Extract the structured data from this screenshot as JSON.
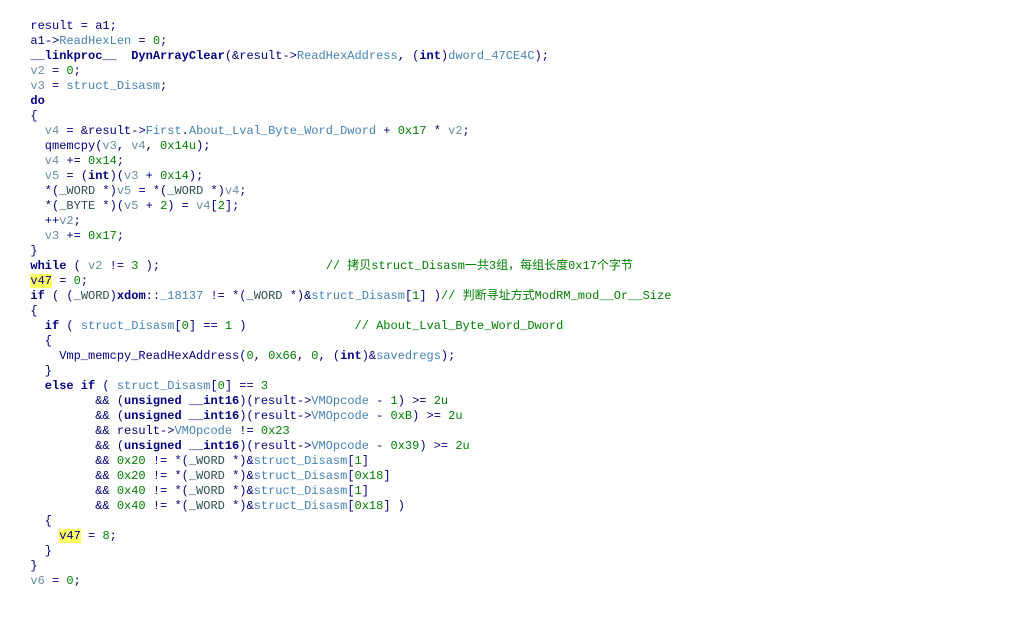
{
  "code": {
    "lines": [
      [
        [
          "ident",
          "  result"
        ],
        [
          "op",
          " = "
        ],
        [
          "ident",
          "a1"
        ],
        [
          "op",
          ";"
        ]
      ],
      [
        [
          "ident",
          "  a1"
        ],
        [
          "op",
          "->"
        ],
        [
          "field",
          "ReadHexLen"
        ],
        [
          "op",
          " = "
        ],
        [
          "num",
          "0"
        ],
        [
          "op",
          ";"
        ]
      ],
      [
        [
          "kw",
          "  __linkproc__  DynArrayClear"
        ],
        [
          "op",
          "(&"
        ],
        [
          "ident",
          "result"
        ],
        [
          "op",
          "->"
        ],
        [
          "field",
          "ReadHexAddress"
        ],
        [
          "op",
          ", ("
        ],
        [
          "kw",
          "int"
        ],
        [
          "op",
          ")"
        ],
        [
          "field",
          "dword_47CE4C"
        ],
        [
          "op",
          ");"
        ]
      ],
      [
        [
          "var",
          "  v2"
        ],
        [
          "op",
          " = "
        ],
        [
          "num",
          "0"
        ],
        [
          "op",
          ";"
        ]
      ],
      [
        [
          "var",
          "  v3"
        ],
        [
          "op",
          " = "
        ],
        [
          "field",
          "struct_Disasm"
        ],
        [
          "op",
          ";"
        ]
      ],
      [
        [
          "kw",
          "  do"
        ]
      ],
      [
        [
          "op",
          "  {"
        ]
      ],
      [
        [
          "var",
          "    v4"
        ],
        [
          "op",
          " = &"
        ],
        [
          "ident",
          "result"
        ],
        [
          "op",
          "->"
        ],
        [
          "field",
          "First"
        ],
        [
          "op",
          "."
        ],
        [
          "field",
          "About_Lval_Byte_Word_Dword"
        ],
        [
          "op",
          " + "
        ],
        [
          "num",
          "0x17"
        ],
        [
          "op",
          " * "
        ],
        [
          "var",
          "v2"
        ],
        [
          "op",
          ";"
        ]
      ],
      [
        [
          "func",
          "    qmemcpy"
        ],
        [
          "op",
          "("
        ],
        [
          "var",
          "v3"
        ],
        [
          "op",
          ", "
        ],
        [
          "var",
          "v4"
        ],
        [
          "op",
          ", "
        ],
        [
          "num",
          "0x14u"
        ],
        [
          "op",
          ");"
        ]
      ],
      [
        [
          "var",
          "    v4"
        ],
        [
          "op",
          " += "
        ],
        [
          "num",
          "0x14"
        ],
        [
          "op",
          ";"
        ]
      ],
      [
        [
          "var",
          "    v5"
        ],
        [
          "op",
          " = ("
        ],
        [
          "kw",
          "int"
        ],
        [
          "op",
          ")("
        ],
        [
          "var",
          "v3"
        ],
        [
          "op",
          " + "
        ],
        [
          "num",
          "0x14"
        ],
        [
          "op",
          ");"
        ]
      ],
      [
        [
          "op",
          "    *("
        ],
        [
          "faint",
          "_WORD"
        ],
        [
          "op",
          " *)"
        ],
        [
          "var",
          "v5"
        ],
        [
          "op",
          " = *("
        ],
        [
          "faint",
          "_WORD"
        ],
        [
          "op",
          " *)"
        ],
        [
          "var",
          "v4"
        ],
        [
          "op",
          ";"
        ]
      ],
      [
        [
          "op",
          "    *("
        ],
        [
          "faint",
          "_BYTE"
        ],
        [
          "op",
          " *)("
        ],
        [
          "var",
          "v5"
        ],
        [
          "op",
          " + "
        ],
        [
          "num",
          "2"
        ],
        [
          "op",
          ") = "
        ],
        [
          "var",
          "v4"
        ],
        [
          "op",
          "["
        ],
        [
          "num",
          "2"
        ],
        [
          "op",
          "];"
        ]
      ],
      [
        [
          "op",
          "    ++"
        ],
        [
          "var",
          "v2"
        ],
        [
          "op",
          ";"
        ]
      ],
      [
        [
          "var",
          "    v3"
        ],
        [
          "op",
          " += "
        ],
        [
          "num",
          "0x17"
        ],
        [
          "op",
          ";"
        ]
      ],
      [
        [
          "op",
          "  }"
        ]
      ],
      [
        [
          "kw",
          "  while"
        ],
        [
          "op",
          " ( "
        ],
        [
          "var",
          "v2"
        ],
        [
          "op",
          " != "
        ],
        [
          "num",
          "3"
        ],
        [
          "op",
          " );                       "
        ],
        [
          "comment",
          "// 拷贝struct_Disasm一共3组，每组长度0x17个字节"
        ]
      ],
      [
        [
          "op",
          "  "
        ],
        [
          "hl",
          "v47"
        ],
        [
          "op",
          " = "
        ],
        [
          "num",
          "0"
        ],
        [
          "op",
          ";"
        ]
      ],
      [
        [
          "kw",
          "  if"
        ],
        [
          "op",
          " ( ("
        ],
        [
          "faint",
          "_WORD"
        ],
        [
          "op",
          ")"
        ],
        [
          "kw",
          "xdom"
        ],
        [
          "op",
          "::"
        ],
        [
          "field",
          "_18137"
        ],
        [
          "op",
          " != *("
        ],
        [
          "faint",
          "_WORD"
        ],
        [
          "op",
          " *)&"
        ],
        [
          "field",
          "struct_Disasm"
        ],
        [
          "op",
          "["
        ],
        [
          "num",
          "1"
        ],
        [
          "op",
          "] )"
        ],
        [
          "comment",
          "// 判断寻址方式ModRM_mod__Or__Size"
        ]
      ],
      [
        [
          "op",
          "  {"
        ]
      ],
      [
        [
          "kw",
          "    if"
        ],
        [
          "op",
          " ( "
        ],
        [
          "field",
          "struct_Disasm"
        ],
        [
          "op",
          "["
        ],
        [
          "num",
          "0"
        ],
        [
          "op",
          "] == "
        ],
        [
          "num",
          "1"
        ],
        [
          "op",
          " )               "
        ],
        [
          "comment",
          "// About_Lval_Byte_Word_Dword"
        ]
      ],
      [
        [
          "op",
          "    {"
        ]
      ],
      [
        [
          "func",
          "      Vmp_memcpy_ReadHexAddress"
        ],
        [
          "op",
          "("
        ],
        [
          "num",
          "0"
        ],
        [
          "op",
          ", "
        ],
        [
          "num",
          "0x66"
        ],
        [
          "op",
          ", "
        ],
        [
          "num",
          "0"
        ],
        [
          "op",
          ", ("
        ],
        [
          "kw",
          "int"
        ],
        [
          "op",
          ")&"
        ],
        [
          "field",
          "savedregs"
        ],
        [
          "op",
          ");"
        ]
      ],
      [
        [
          "op",
          "    }"
        ]
      ],
      [
        [
          "kw",
          "    else if"
        ],
        [
          "op",
          " ( "
        ],
        [
          "field",
          "struct_Disasm"
        ],
        [
          "op",
          "["
        ],
        [
          "num",
          "0"
        ],
        [
          "op",
          "] == "
        ],
        [
          "num",
          "3"
        ]
      ],
      [
        [
          "op",
          "           && ("
        ],
        [
          "kw",
          "unsigned __int16"
        ],
        [
          "op",
          ")("
        ],
        [
          "ident",
          "result"
        ],
        [
          "op",
          "->"
        ],
        [
          "field",
          "VMOpcode"
        ],
        [
          "op",
          " - "
        ],
        [
          "num",
          "1"
        ],
        [
          "op",
          ") >= "
        ],
        [
          "num",
          "2u"
        ]
      ],
      [
        [
          "op",
          "           && ("
        ],
        [
          "kw",
          "unsigned __int16"
        ],
        [
          "op",
          ")("
        ],
        [
          "ident",
          "result"
        ],
        [
          "op",
          "->"
        ],
        [
          "field",
          "VMOpcode"
        ],
        [
          "op",
          " - "
        ],
        [
          "num",
          "0xB"
        ],
        [
          "op",
          ") >= "
        ],
        [
          "num",
          "2u"
        ]
      ],
      [
        [
          "op",
          "           && "
        ],
        [
          "ident",
          "result"
        ],
        [
          "op",
          "->"
        ],
        [
          "field",
          "VMOpcode"
        ],
        [
          "op",
          " != "
        ],
        [
          "num",
          "0x23"
        ]
      ],
      [
        [
          "op",
          "           && ("
        ],
        [
          "kw",
          "unsigned __int16"
        ],
        [
          "op",
          ")("
        ],
        [
          "ident",
          "result"
        ],
        [
          "op",
          "->"
        ],
        [
          "field",
          "VMOpcode"
        ],
        [
          "op",
          " - "
        ],
        [
          "num",
          "0x39"
        ],
        [
          "op",
          ") >= "
        ],
        [
          "num",
          "2u"
        ]
      ],
      [
        [
          "op",
          "           && "
        ],
        [
          "num",
          "0x20"
        ],
        [
          "op",
          " != *("
        ],
        [
          "faint",
          "_WORD"
        ],
        [
          "op",
          " *)&"
        ],
        [
          "field",
          "struct_Disasm"
        ],
        [
          "op",
          "["
        ],
        [
          "num",
          "1"
        ],
        [
          "op",
          "]"
        ]
      ],
      [
        [
          "op",
          "           && "
        ],
        [
          "num",
          "0x20"
        ],
        [
          "op",
          " != *("
        ],
        [
          "faint",
          "_WORD"
        ],
        [
          "op",
          " *)&"
        ],
        [
          "field",
          "struct_Disasm"
        ],
        [
          "op",
          "["
        ],
        [
          "num",
          "0x18"
        ],
        [
          "op",
          "]"
        ]
      ],
      [
        [
          "op",
          "           && "
        ],
        [
          "num",
          "0x40"
        ],
        [
          "op",
          " != *("
        ],
        [
          "faint",
          "_WORD"
        ],
        [
          "op",
          " *)&"
        ],
        [
          "field",
          "struct_Disasm"
        ],
        [
          "op",
          "["
        ],
        [
          "num",
          "1"
        ],
        [
          "op",
          "]"
        ]
      ],
      [
        [
          "op",
          "           && "
        ],
        [
          "num",
          "0x40"
        ],
        [
          "op",
          " != *("
        ],
        [
          "faint",
          "_WORD"
        ],
        [
          "op",
          " *)&"
        ],
        [
          "field",
          "struct_Disasm"
        ],
        [
          "op",
          "["
        ],
        [
          "num",
          "0x18"
        ],
        [
          "op",
          "] )"
        ]
      ],
      [
        [
          "op",
          "    {"
        ]
      ],
      [
        [
          "op",
          "      "
        ],
        [
          "hl",
          "v47"
        ],
        [
          "op",
          " = "
        ],
        [
          "num",
          "8"
        ],
        [
          "op",
          ";"
        ]
      ],
      [
        [
          "op",
          "    }"
        ]
      ],
      [
        [
          "op",
          "  }"
        ]
      ],
      [
        [
          "var",
          "  v6"
        ],
        [
          "op",
          " = "
        ],
        [
          "num",
          "0"
        ],
        [
          "op",
          ";"
        ]
      ]
    ]
  }
}
